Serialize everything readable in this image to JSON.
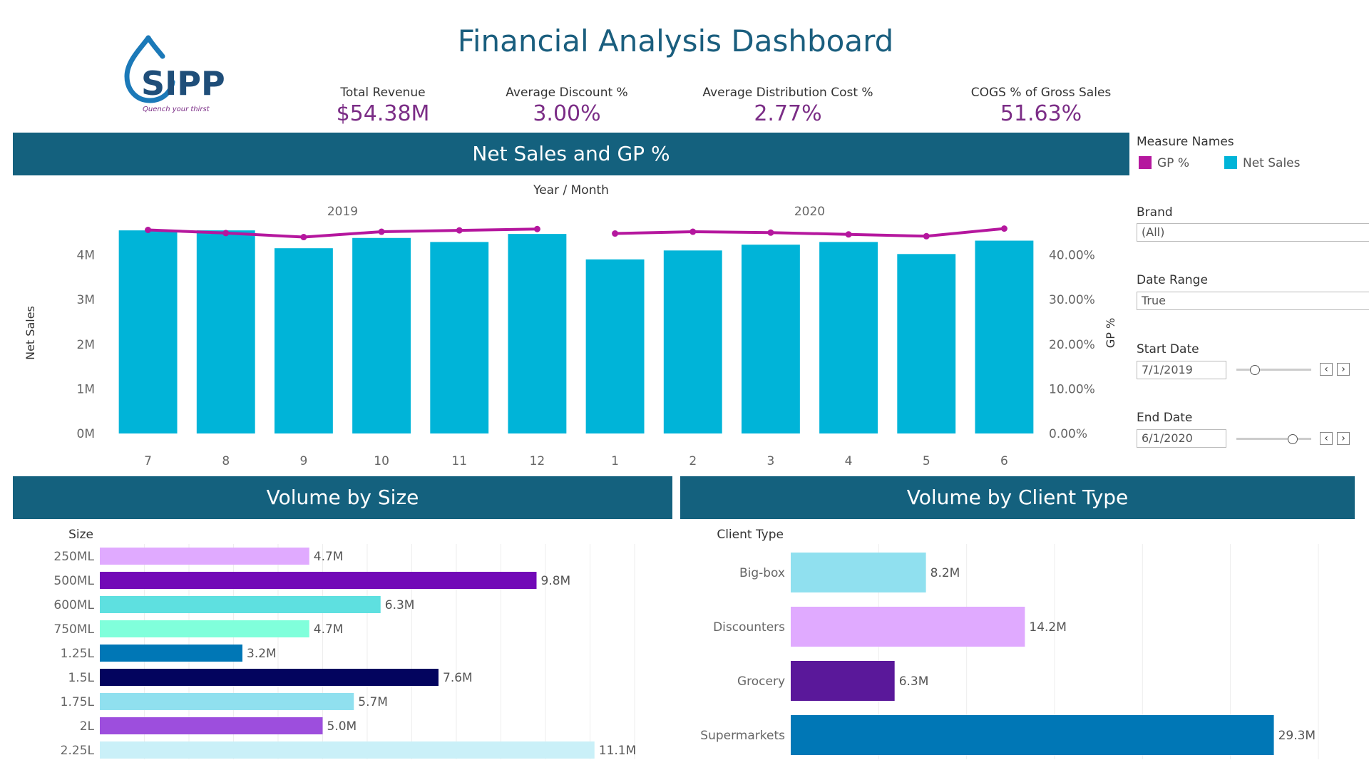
{
  "header": {
    "title": "Financial Analysis Dashboard",
    "logo_text": "SIPP",
    "logo_tagline": "Quench your thirst"
  },
  "kpis": [
    {
      "label": "Total Revenue",
      "value": "$54.38M"
    },
    {
      "label": "Average Discount %",
      "value": "3.00%"
    },
    {
      "label": "Average Distribution Cost %",
      "value": "2.77%"
    },
    {
      "label": "COGS % of Gross Sales",
      "value": "51.63%"
    }
  ],
  "sections": {
    "net_sales": "Net Sales and GP %",
    "volume_size": "Volume by Size",
    "volume_client": "Volume by Client Type"
  },
  "legend": {
    "title": "Measure Names",
    "items": [
      {
        "label": "GP %",
        "color": "#b5179e"
      },
      {
        "label": "Net Sales",
        "color": "#00b4d8"
      }
    ]
  },
  "filters": {
    "brand": {
      "label": "Brand",
      "value": "(All)"
    },
    "date_range": {
      "label": "Date Range",
      "value": "True"
    },
    "start_date": {
      "label": "Start Date",
      "value": "7/1/2019",
      "slider_position": 0.25
    },
    "end_date": {
      "label": "End Date",
      "value": "6/1/2020",
      "slider_position": 0.75
    }
  },
  "chart_data": [
    {
      "type": "bar",
      "title": "Net Sales and GP %",
      "xlabel": "Year / Month",
      "ylabel": "Net Sales",
      "y2label": "GP %",
      "year_groups": [
        {
          "year": "2019",
          "months": [
            "7",
            "8",
            "9",
            "10",
            "11",
            "12"
          ]
        },
        {
          "year": "2020",
          "months": [
            "1",
            "2",
            "3",
            "4",
            "5",
            "6"
          ]
        }
      ],
      "categories": [
        "7",
        "8",
        "9",
        "10",
        "11",
        "12",
        "1",
        "2",
        "3",
        "4",
        "5",
        "6"
      ],
      "yticks": [
        "0M",
        "1M",
        "2M",
        "3M",
        "4M"
      ],
      "y2ticks": [
        "0.00%",
        "10.00%",
        "20.00%",
        "30.00%",
        "40.00%"
      ],
      "ylim": [
        0,
        4600000
      ],
      "y2lim": [
        0,
        46
      ],
      "series": [
        {
          "name": "Net Sales",
          "color": "#00b4d8",
          "values": [
            4550000,
            4550000,
            4150000,
            4380000,
            4290000,
            4470000,
            3900000,
            4100000,
            4230000,
            4290000,
            4020000,
            4320000
          ]
        },
        {
          "name": "GP %",
          "color": "#b5179e",
          "values": [
            45.6,
            44.9,
            44.0,
            45.2,
            45.5,
            45.8,
            44.8,
            45.2,
            45.0,
            44.6,
            44.2,
            45.9
          ]
        }
      ],
      "grid": false,
      "legend": "right"
    },
    {
      "type": "bar",
      "orientation": "horizontal",
      "title": "Volume by Size",
      "ylabel": "Size",
      "categories": [
        "250ML",
        "500ML",
        "600ML",
        "750ML",
        "1.25L",
        "1.5L",
        "1.75L",
        "2L",
        "2.25L"
      ],
      "values": [
        4.7,
        9.8,
        6.3,
        4.7,
        3.2,
        7.6,
        5.7,
        5.0,
        11.1
      ],
      "value_labels": [
        "4.7M",
        "9.8M",
        "6.3M",
        "4.7M",
        "3.2M",
        "7.6M",
        "5.7M",
        "5.0M",
        "11.1M"
      ],
      "colors": [
        "#e0aaff",
        "#7209b7",
        "#5ee0e0",
        "#80ffdb",
        "#0077b6",
        "#03045e",
        "#90e0ef",
        "#9d4edd",
        "#caf0f8"
      ],
      "xlim": [
        0,
        12
      ]
    },
    {
      "type": "bar",
      "orientation": "horizontal",
      "title": "Volume by Client Type",
      "ylabel": "Client Type",
      "categories": [
        "Big-box",
        "Discounters",
        "Grocery",
        "Supermarkets"
      ],
      "values": [
        8.2,
        14.2,
        6.3,
        29.3
      ],
      "value_labels": [
        "8.2M",
        "14.2M",
        "6.3M",
        "29.3M"
      ],
      "colors": [
        "#90e0ef",
        "#e0aaff",
        "#5a189a",
        "#0077b6"
      ],
      "xlim": [
        0,
        32
      ]
    }
  ]
}
